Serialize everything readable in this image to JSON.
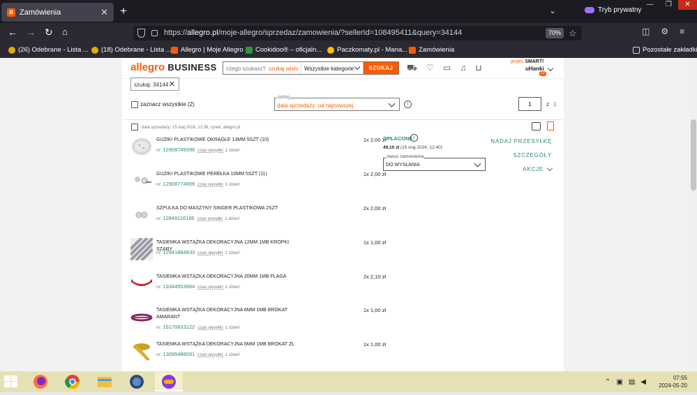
{
  "browser": {
    "tab_title": "Zamówienia",
    "tab_favicon": "a",
    "private_label": "Tryb prywatny",
    "url_prefix": "https://",
    "url_domain": "allegro.pl",
    "url_rest": "/moje-allegro/sprzedaz/zamowienia/?sellerId=108495411&query=34144",
    "zoom": "70%",
    "bookmarks": [
      {
        "label": "(26) Odebrane - Lista ...",
        "color": "#e0b000"
      },
      {
        "label": "(18) Odebrane - Lista ...",
        "color": "#e0b000"
      },
      {
        "label": "Allegro | Moje Allegro",
        "color": "#ff5a00"
      },
      {
        "label": "Cookidoo® – oficjaln...",
        "color": "#2a9a3a"
      },
      {
        "label": "Paczkomaty.pl - Mana...",
        "color": "#f5c400"
      },
      {
        "label": "Zamówienia",
        "color": "#ff5a00"
      }
    ],
    "other_bookmarks": "Pozostałe zakładki"
  },
  "header": {
    "logo_main": "allegro",
    "logo_sub": "BUSINESS",
    "search_placeholder": "czego szukasz?",
    "search_many": "szukaj wielu",
    "category": "Wszystkie kategorie",
    "search_button": "SZUKAJ",
    "smart_prefix": "jesteś",
    "smart_label": "SMART!",
    "username": "uHanki",
    "notifications": "12"
  },
  "filters": {
    "chip": "szukaj: 34144",
    "select_all": "zaznacz wszystkie (2)",
    "sort_label": "sortuj",
    "sort_value": "data sprzedaży: od najnowszej",
    "page_current": "1",
    "page_of": "z",
    "page_total": "1"
  },
  "order": {
    "meta": "data sprzedaży: 15 maj 2024, 12:38; rynek: allegro.pl",
    "paid_label": "OPŁACONE",
    "paid_amount": "49,10 zł",
    "paid_date": "(15 maj 2024, 12:40)",
    "status_label": "status zamówienia",
    "status_value": "DO WYSŁANIA",
    "action_ship": "NADAJ PRZESYŁKĘ",
    "action_details": "SZCZEGÓŁY",
    "action_actions": "AKCJE",
    "nr_prefix": "nr:",
    "ship_prefix": "czas wysyłki:",
    "items": [
      {
        "name": "GUZIKI PLASTIKOWE OKRĄGŁE 13mm 5szt (10)",
        "nr": "12908749396",
        "ship": "1 dzień",
        "qty": "1x 2,00 zł"
      },
      {
        "name": "GUZIKI PLASTIKOWE PEREŁKA 10mm 5szt (11)",
        "nr": "12908774909",
        "ship": "1 dzień",
        "qty": "1x 2,00 zł"
      },
      {
        "name": "SZPULKA DO MASZYNY SINGER PLASTIKOWA 2szt",
        "nr": "12848116186",
        "ship": "1 dzień",
        "qty": "2x 2,00 zł"
      },
      {
        "name": "TASIEMKA WSTĄŻKA DEKORACYJNA 12mm 1mb KROPKI SZARY",
        "nr": "12941884833",
        "ship": "1 dzień",
        "qty": "1x 1,00 zł"
      },
      {
        "name": "TASIEMKA WSTĄŻKA DEKORACYJNA 20mm 1mb FLAGA",
        "nr": "13344553964",
        "ship": "1 dzień",
        "qty": "2x 2,10 zł"
      },
      {
        "name": "TASIEMKA WSTĄŻKA DEKORACYJNA 6mm 1mb BROKAT AMARANT",
        "nr": "15170833122",
        "ship": "1 dzień",
        "qty": "1x 1,00 zł"
      },
      {
        "name": "TASIEMKA WSTĄŻKA DEKORACYJNA 6mm 1mb BROKAT ZŁ",
        "nr": "13095488091",
        "ship": "1 dzień",
        "qty": "1x 1,00 zł"
      }
    ]
  },
  "taskbar": {
    "time": "07:55",
    "date": "2024-05-20"
  }
}
